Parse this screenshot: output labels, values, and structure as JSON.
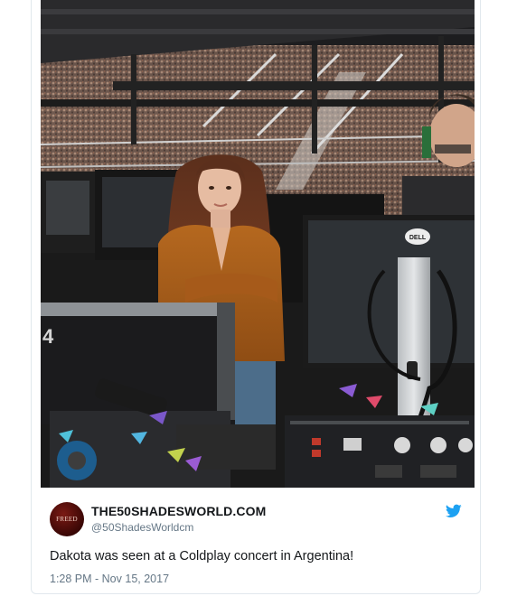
{
  "tweet": {
    "display_name": "THE50SHADESWORLD.COM",
    "handle": "@50ShadesWorldcm",
    "avatar_text": "FREED",
    "text": "Dakota was seen at a Coldplay concert in Argentina!",
    "timestamp": "1:28 PM - Nov 15, 2017",
    "icon": "twitter-bird-icon",
    "accent_color": "#1da1f2"
  },
  "media": {
    "monitor_brand": "DELL",
    "equipment_text": "4"
  }
}
